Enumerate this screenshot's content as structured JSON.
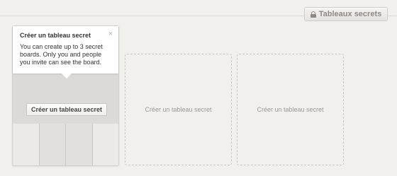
{
  "header": {
    "secret_boards_button": {
      "label": "Tableaux secrets",
      "icon": "lock-icon"
    }
  },
  "first_card": {
    "create_button_label": "Créer un tableau secret"
  },
  "tooltip": {
    "title": "Créer un tableau secret",
    "body": "You can create up to 3 secret boards. Only you and people you invite can see the board.",
    "close_symbol": "×"
  },
  "placeholders": [
    {
      "label": "Créer un tableau secret"
    },
    {
      "label": "Créer un tableau secret"
    }
  ]
}
